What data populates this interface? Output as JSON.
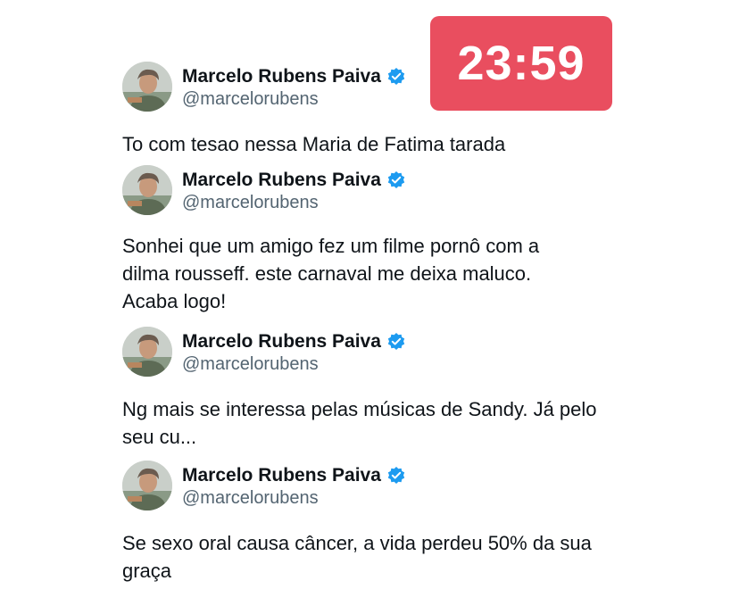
{
  "timer": {
    "label": "23:59",
    "color": "#e94e5f"
  },
  "tweets": [
    {
      "author": "Marcelo Rubens Paiva",
      "handle": "@marcelorubens",
      "text": "To com tesao nessa Maria de Fatima tarada",
      "verified_icon": "verified-badge-icon"
    },
    {
      "author": "Marcelo Rubens Paiva",
      "handle": "@marcelorubens",
      "text": "Sonhei que um amigo fez um filme pornô com a dilma rousseff. este carnaval me deixa maluco. Acaba logo!",
      "verified_icon": "verified-badge-icon"
    },
    {
      "author": "Marcelo Rubens Paiva",
      "handle": "@marcelorubens",
      "text": "Ng mais se interessa pelas músicas de Sandy. Já pelo seu cu...",
      "verified_icon": "verified-badge-icon"
    },
    {
      "author": "Marcelo Rubens Paiva",
      "handle": "@marcelorubens",
      "text": "Se sexo oral causa câncer, a vida perdeu 50% da sua graça",
      "verified_icon": "verified-badge-icon"
    }
  ],
  "colors": {
    "verified": "#1d9bf0",
    "handle": "#536471",
    "text": "#0f1419"
  }
}
